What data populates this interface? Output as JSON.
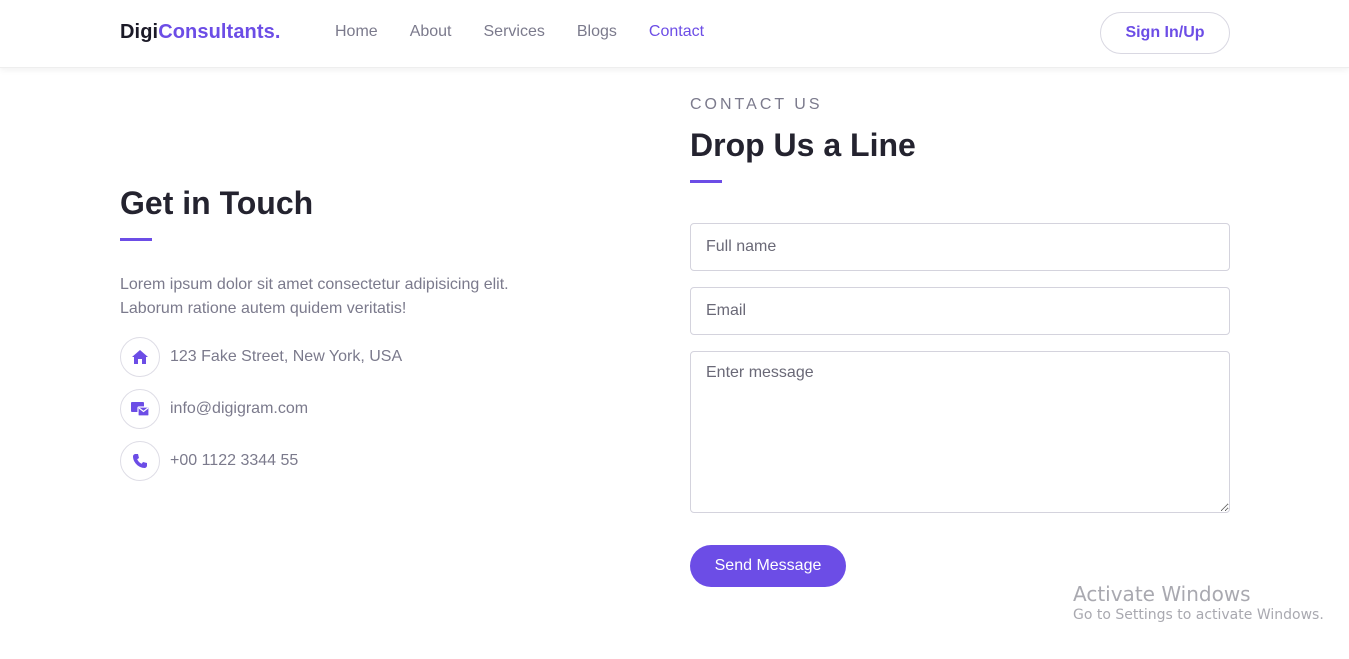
{
  "header": {
    "brand_part1": "Digi",
    "brand_part2": "Consultants.",
    "nav": [
      {
        "label": "Home"
      },
      {
        "label": "About"
      },
      {
        "label": "Services"
      },
      {
        "label": "Blogs"
      },
      {
        "label": "Contact",
        "active": true
      }
    ],
    "signin_label": "Sign In/Up"
  },
  "contact_info": {
    "title": "Get in Touch",
    "description": "Lorem ipsum dolor sit amet consectetur adipisicing elit. Laborum ratione autem quidem veritatis!",
    "items": [
      {
        "icon": "home-icon",
        "text": "123 Fake Street, New York, USA"
      },
      {
        "icon": "mail-icon",
        "text": "info@digigram.com"
      },
      {
        "icon": "phone-icon",
        "text": "+00 1122 3344 55"
      }
    ]
  },
  "form": {
    "eyebrow": "CONTACT US",
    "title": "Drop Us a Line",
    "fullname_placeholder": "Full name",
    "email_placeholder": "Email",
    "message_placeholder": "Enter message",
    "submit_label": "Send Message"
  },
  "watermark": {
    "line1": "Activate Windows",
    "line2": "Go to Settings to activate Windows."
  },
  "colors": {
    "accent": "#6c4de6",
    "text_muted": "#7b7a8c",
    "heading": "#24232f"
  }
}
